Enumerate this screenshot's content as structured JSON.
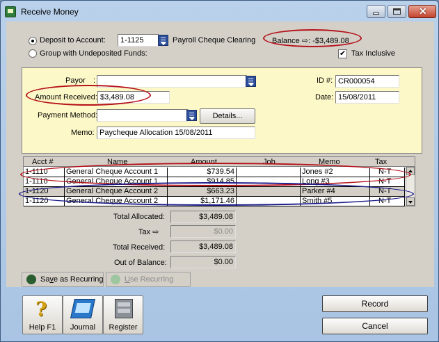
{
  "window": {
    "title": "Receive Money"
  },
  "deposit": {
    "deposit_label": "Deposit to Account:",
    "group_label": "Group with Undeposited Funds:",
    "account_number": "1-1125",
    "account_name": "Payroll Cheque Clearing",
    "balance_label": "Balance",
    "balance_value": ": -$3,489.08",
    "tax_inclusive_label": "Tax Inclusive",
    "tax_inclusive_checked": true
  },
  "form": {
    "payor_label": "Payor",
    "payor_colon": ":",
    "payor_value": "",
    "amount_label": "Amount Received:",
    "amount_value": "$3,489.08",
    "payment_method_label": "Payment Method:",
    "payment_method_value": "",
    "details_label": "Details...",
    "memo_label": "Memo:",
    "memo_value": "Paycheque Allocation 15/08/2011",
    "id_label": "ID #:",
    "id_value": "CR000054",
    "date_label": "Date:",
    "date_value": "15/08/2011"
  },
  "table": {
    "columns": [
      "Acct #",
      "Name",
      "Amount",
      "Job",
      "Memo",
      "Tax"
    ],
    "rows": [
      {
        "acct": "1-1110",
        "name": "General Cheque Account 1",
        "amount": "$739.54",
        "job": "",
        "memo": "Jones #2",
        "tax": "N-T"
      },
      {
        "acct": "1-1110",
        "name": "General Cheque Account 1",
        "amount": "$914.85",
        "job": "",
        "memo": "Long #3",
        "tax": "N-T"
      },
      {
        "acct": "1-1120",
        "name": "General Cheque Account 2",
        "amount": "$663.23",
        "job": "",
        "memo": "Parker #4",
        "tax": "N-T"
      },
      {
        "acct": "1-1120",
        "name": "General Cheque Account 2",
        "amount": "$1,171.46",
        "job": "",
        "memo": "Smith #5",
        "tax": "N-T"
      }
    ]
  },
  "totals": {
    "allocated_label": "Total Allocated:",
    "allocated_value": "$3,489.08",
    "tax_label": "Tax",
    "tax_value": "$0.00",
    "received_label": "Total Received:",
    "received_value": "$3,489.08",
    "out_of_balance_label": "Out of Balance:",
    "out_of_balance_value": "$0.00"
  },
  "recurring": {
    "save_label_pre": "Sa",
    "save_label_key": "v",
    "save_label_post": "e as Recurring",
    "use_label_key": "U",
    "use_label_post": "se Recurring"
  },
  "toolbar": {
    "help_label": "Help F1",
    "journal_label": "Journal",
    "register_label": "Register"
  },
  "actions": {
    "record_label": "Record",
    "cancel_label": "Cancel"
  },
  "colors": {
    "highlight_red": "#b5121b",
    "highlight_blue": "#1a1a8a",
    "form_background": "#fdf8c7"
  }
}
